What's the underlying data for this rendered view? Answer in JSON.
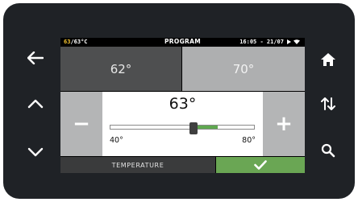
{
  "status": {
    "probe_value": "63",
    "setpoint_value": "/63°C",
    "title": "PROGRAM",
    "time_date": "16:05 - 21/07"
  },
  "presets": {
    "low": "62°",
    "high": "70°"
  },
  "adjust": {
    "minus": "−",
    "plus": "+"
  },
  "temperature": {
    "current": "63°",
    "min_label": "40°",
    "max_label": "80°",
    "min": 40,
    "max": 80,
    "value": 63,
    "target": 70
  },
  "footer": {
    "label": "TEMPERATURE"
  },
  "side_buttons": {
    "left": [
      "back-arrow-icon",
      "chevron-up-icon",
      "chevron-down-icon"
    ],
    "right": [
      "home-icon",
      "sort-arrows-icon",
      "search-icon"
    ]
  },
  "colors": {
    "accent_green": "#6aa654",
    "highlight_yellow": "#f2c230",
    "bezel": "#1f2226"
  }
}
